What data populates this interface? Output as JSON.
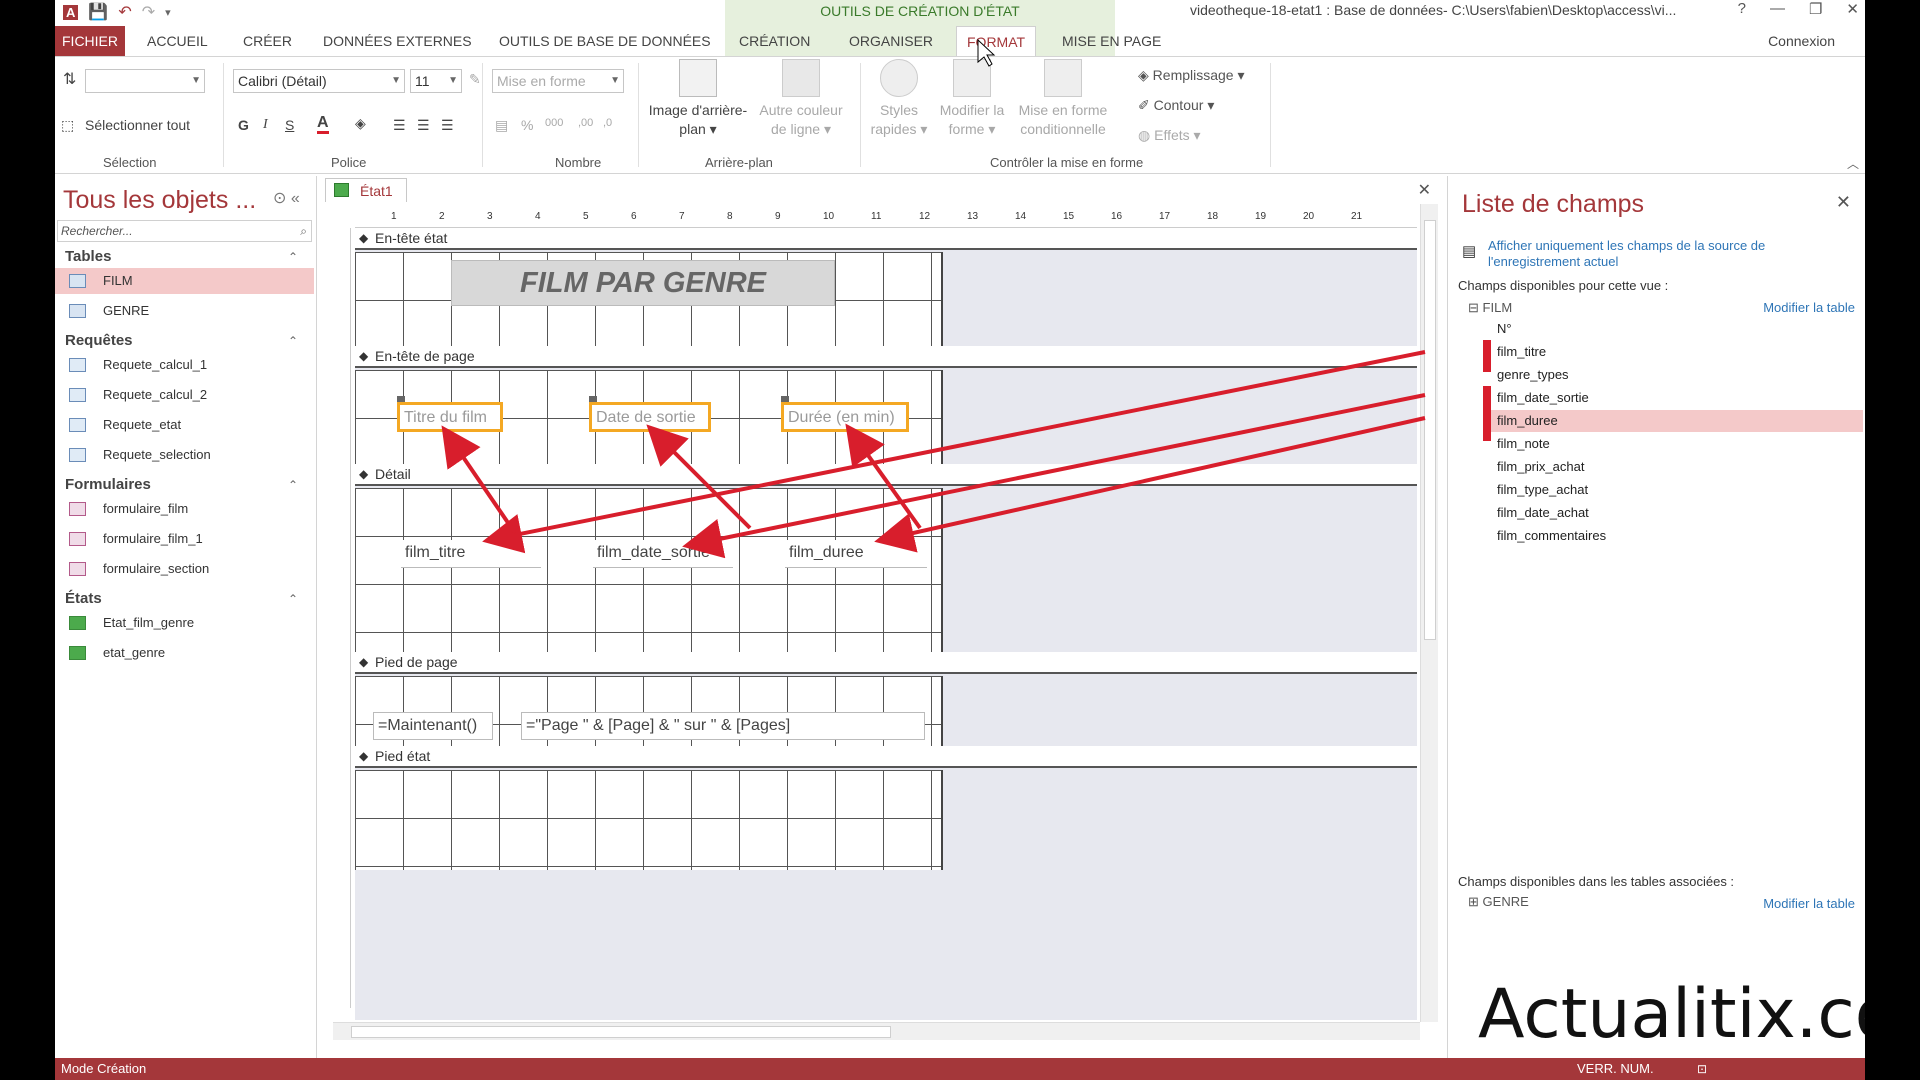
{
  "titlebar": {
    "context_header": "OUTILS DE CRÉATION D'ÉTAT",
    "window_title": "videotheque-18-etat1 : Base de données- C:\\Users\\fabien\\Desktop\\access\\vi...",
    "help": "?",
    "minimize": "—",
    "restore": "❐",
    "close": "✕"
  },
  "tabs": {
    "fichier": "FICHIER",
    "accueil": "ACCUEIL",
    "creer": "CRÉER",
    "donnees_externes": "DONNÉES EXTERNES",
    "outils_bdd": "OUTILS DE BASE DE DONNÉES",
    "creation": "CRÉATION",
    "organiser": "ORGANISER",
    "format": "FORMAT",
    "mise_en_page": "MISE EN PAGE",
    "connexion": "Connexion"
  },
  "ribbon": {
    "selection_all": "Sélectionner tout",
    "selection_label": "Sélection",
    "font_name": "Calibri (Détail)",
    "font_size": "11",
    "bold": "G",
    "italic": "I",
    "underline": "S",
    "police_label": "Police",
    "mise_en_forme": "Mise en forme",
    "nombre_label": "Nombre",
    "percent": "%",
    "thousands": "000",
    "dec_inc": ",00",
    "dec_dec": ",0",
    "image_arriere_plan": "Image d'arrière-plan",
    "autre_couleur": "Autre couleur de ligne",
    "arriere_plan_label": "Arrière-plan",
    "styles_rapides": "Styles rapides",
    "modifier_forme": "Modifier la forme",
    "mise_en_forme_cond": "Mise en forme conditionnelle",
    "remplissage": "Remplissage",
    "contour": "Contour",
    "effets": "Effets",
    "controler_label": "Contrôler la mise en forme"
  },
  "nav": {
    "title": "Tous les objets ...",
    "search_placeholder": "Rechercher...",
    "categories": {
      "tables": "Tables",
      "requetes": "Requêtes",
      "formulaires": "Formulaires",
      "etats": "États"
    },
    "tables": [
      "FILM",
      "GENRE"
    ],
    "requetes": [
      "Requete_calcul_1",
      "Requete_calcul_2",
      "Requete_etat",
      "Requete_selection"
    ],
    "formulaires": [
      "formulaire_film",
      "formulaire_film_1",
      "formulaire_section"
    ],
    "etats": [
      "Etat_film_genre",
      "etat_genre"
    ]
  },
  "doc": {
    "tab_label": "État1",
    "ruler_numbers": [
      "1",
      "2",
      "3",
      "4",
      "5",
      "6",
      "7",
      "8",
      "9",
      "10",
      "11",
      "12",
      "13",
      "14",
      "15",
      "16",
      "17",
      "18",
      "19",
      "20",
      "21"
    ],
    "sections": {
      "entete_etat": "En-tête état",
      "entete_page": "En-tête de page",
      "detail": "Détail",
      "pied_page": "Pied de page",
      "pied_etat": "Pied état"
    },
    "report_title": "FILM PAR GENRE",
    "header_labels": [
      "Titre du film",
      "Date de sortie",
      "Durée (en min)"
    ],
    "detail_fields": [
      "film_titre",
      "film_date_sortie",
      "film_duree"
    ],
    "footer_now": "=Maintenant()",
    "footer_pages": "=\"Page \" & [Page] & \" sur \" & [Pages]"
  },
  "field_list": {
    "title": "Liste de champs",
    "show_only_link": "Afficher uniquement les champs de la source de l'enregistrement actuel",
    "available_label": "Champs disponibles pour cette vue :",
    "table_name": "FILM",
    "modify_table": "Modifier la table",
    "fields": [
      "N°",
      "film_titre",
      "genre_types",
      "film_date_sortie",
      "film_duree",
      "film_note",
      "film_prix_achat",
      "film_type_achat",
      "film_date_achat",
      "film_commentaires"
    ],
    "related_label": "Champs disponibles dans les tables associées :",
    "related_table": "GENRE",
    "modify_table_2": "Modifier la table"
  },
  "status": {
    "mode": "Mode Création",
    "verr_num": "VERR. NUM."
  },
  "watermark": "Actualitix.com",
  "colors": {
    "accent": "#a4373a",
    "context_green": "#e6f0dd",
    "selection_orange": "#f4a823",
    "annotation_red": "#d81e2c",
    "highlight_pink": "#f4c9c9"
  }
}
